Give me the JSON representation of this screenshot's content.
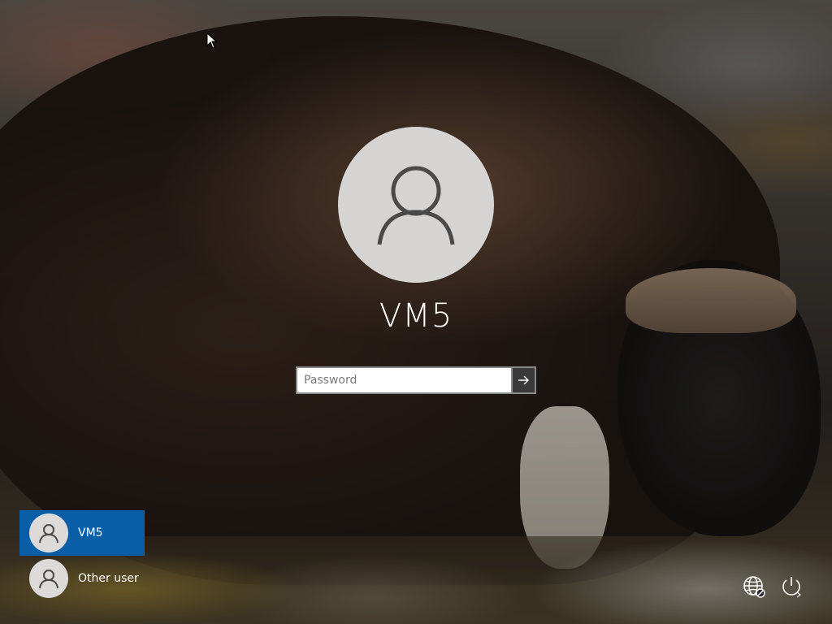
{
  "login": {
    "username": "VM5",
    "password_placeholder": "Password",
    "submit_icon": "arrow-right-icon"
  },
  "user_list": [
    {
      "name": "VM5",
      "selected": true,
      "icon": "user-icon"
    },
    {
      "name": "Other user",
      "selected": false,
      "icon": "user-icon"
    }
  ],
  "system_icons": {
    "network": "network-globe-icon",
    "power": "power-icon"
  },
  "colors": {
    "selected_tile": "#0a5ea8",
    "avatar_bg": "#d6d4d2",
    "submit_bg": "#3a3a3a",
    "text": "#ffffff"
  }
}
